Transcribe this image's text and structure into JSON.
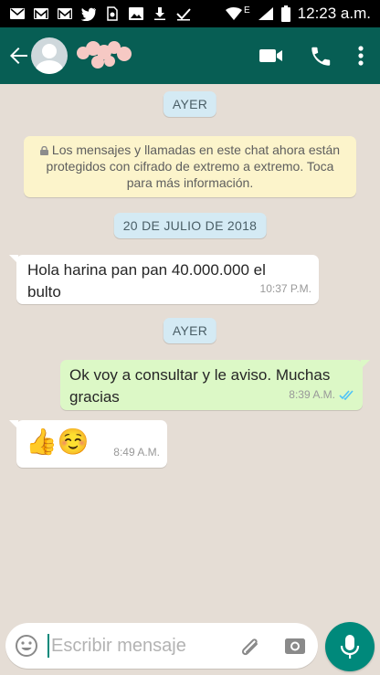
{
  "status_bar": {
    "time": "12:23 a.m.",
    "network_label": "E",
    "icons": [
      "mail-icon",
      "gmail-icon",
      "gmail-icon",
      "twitter-icon",
      "sim-icon",
      "image-icon",
      "download-icon",
      "check-icon",
      "wifi-icon",
      "signal-icon",
      "battery-icon"
    ]
  },
  "app_bar": {
    "back_icon": "arrow-left-icon",
    "actions": [
      "video-call-icon",
      "voice-call-icon",
      "more-vert-icon"
    ],
    "colors": {
      "background": "#075e54"
    }
  },
  "chat": {
    "chips": {
      "ayer_1": "AYER",
      "date": "20 DE JULIO DE 2018",
      "ayer_2": "AYER"
    },
    "encryption_notice": "Los mensajes y llamadas en este chat ahora están protegidos con cifrado de extremo a extremo. Toca para más información.",
    "messages": [
      {
        "direction": "in",
        "text": "Hola harina pan pan 40.000.000 el bulto",
        "time": "10:37 P.M."
      },
      {
        "direction": "out",
        "text": "Ok voy a consultar y le aviso. Muchas gracias",
        "time": "8:39 A.M.",
        "status_icon": "double-check-icon"
      },
      {
        "direction": "in",
        "text": "👍☺️",
        "time": "8:49 A.M."
      }
    ],
    "colors": {
      "background": "#e5ddd5",
      "outgoing": "#dcf8c6",
      "incoming": "#ffffff",
      "notice": "#fcf4cb",
      "chip": "#d4eaf4",
      "read_tick": "#4fc3f7"
    }
  },
  "composer": {
    "placeholder": "Escribir mensaje",
    "value": "",
    "icons": [
      "emoji-icon",
      "attach-icon",
      "camera-icon",
      "mic-icon"
    ],
    "colors": {
      "mic_button": "#00897b"
    }
  }
}
